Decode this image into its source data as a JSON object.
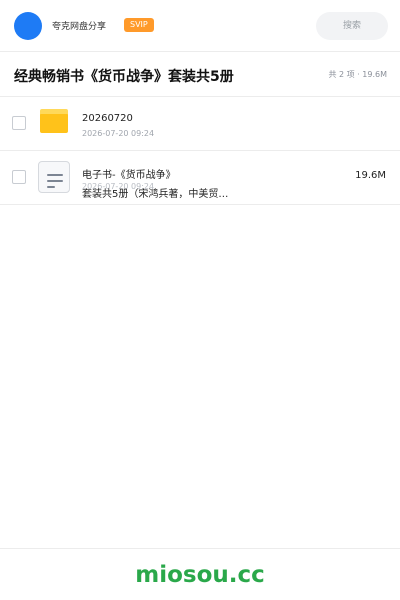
{
  "topbar": {
    "brand": "夸克网盘分享",
    "badge": "SVIP",
    "search_label": "搜索"
  },
  "header": {
    "title": "经典畅销书《货币战争》套装共5册",
    "meta": "共 2 项 · 19.6M"
  },
  "files": [
    {
      "name": "20260720",
      "date": "2026-07-20 09:24",
      "size": "",
      "icon": "folder-icon"
    },
    {
      "name_line1": "电子书-《货币战争》",
      "name_line2": "套装共5册（宋鸿兵著，中美贸…",
      "date": "2026-07-20 09:24",
      "size": "19.6M",
      "icon": "document-icon"
    }
  ],
  "footer": {
    "brand": "miosou.cc"
  },
  "colors": {
    "accent": "#1e7bf5",
    "svip": "#ff9a2a",
    "folder": "#ffc21a",
    "footer_brand": "#2aa84a"
  }
}
